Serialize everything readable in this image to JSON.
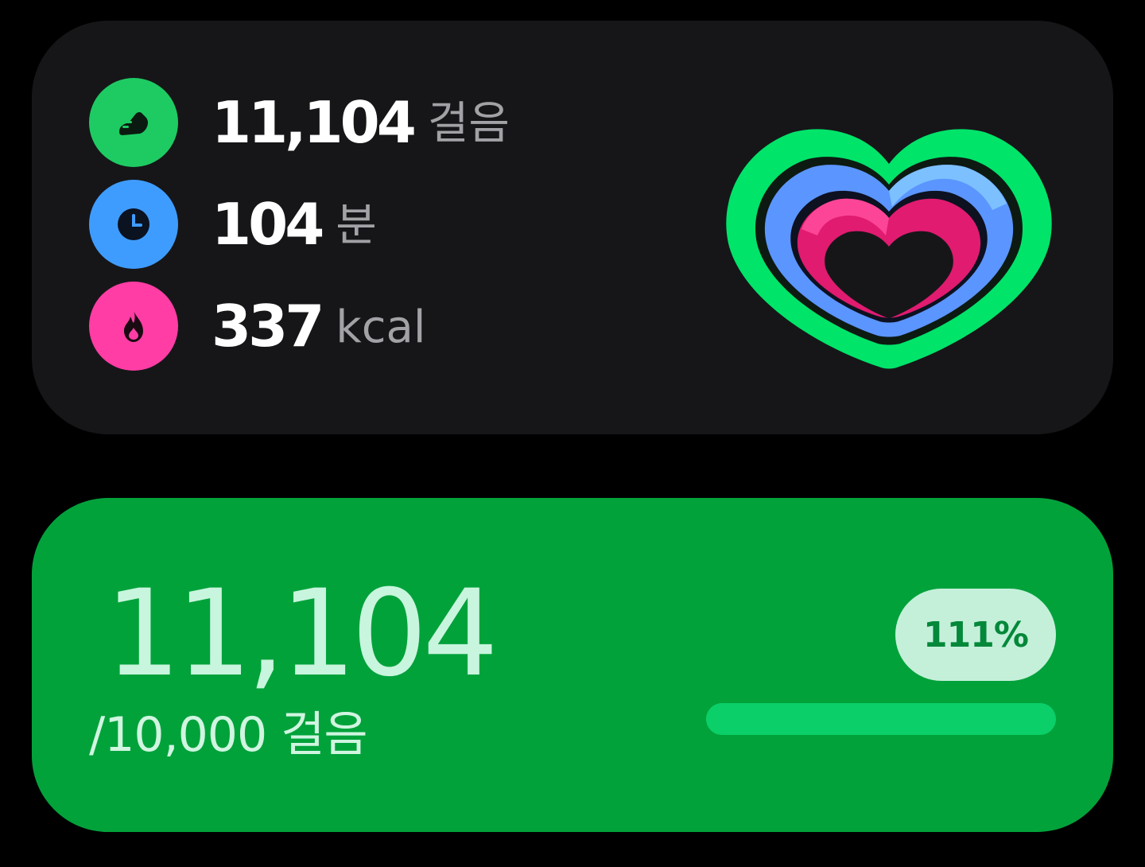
{
  "summary": {
    "steps": {
      "value": "11,104",
      "unit": "걸음",
      "icon": "shoe-icon",
      "color": "#1ecb63"
    },
    "active_time": {
      "value": "104",
      "unit": "분",
      "icon": "clock-icon",
      "color": "#3f9cff"
    },
    "calories": {
      "value": "337",
      "unit": "kcal",
      "icon": "flame-icon",
      "color": "#ff3da5"
    },
    "rings": {
      "icon": "activity-heart-icon",
      "steps_color": "#00e46a",
      "active_time_color": "#5b95ff",
      "calories_color": "#f0327f"
    }
  },
  "step_goal": {
    "current": "11,104",
    "goal": "/10,000 걸음",
    "percent_label": "111%",
    "progress_fraction": 1.0,
    "card_color": "#02a23b",
    "bar_color": "#0bcf68"
  }
}
